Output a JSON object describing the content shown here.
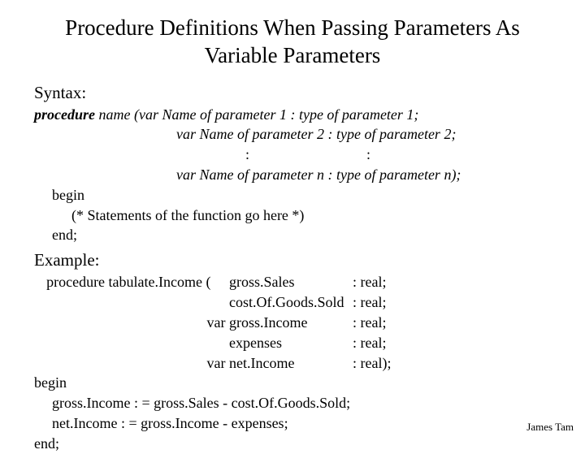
{
  "title": "Procedure Definitions When Passing Parameters As Variable Parameters",
  "syntax": {
    "heading": "Syntax:",
    "line1_kw": "procedure",
    "line1_rest": " name (var Name of parameter 1 : type of parameter 1;",
    "line2": "var Name of parameter 2 : type of parameter 2;",
    "line3": ":                                :",
    "line4": "var Name of parameter n : type of parameter n);",
    "begin": "begin",
    "body": "(* Statements of the function go here *)",
    "end": "end;"
  },
  "example": {
    "heading": "Example:",
    "sig_prefix": "procedure tabulate.Income (",
    "params": [
      {
        "prefix": "procedure tabulate.Income (     ",
        "name": "gross.Sales",
        "type": ": real;"
      },
      {
        "prefix": "",
        "name": "cost.Of.Goods.Sold ",
        "type": ": real;"
      },
      {
        "prefix": "var ",
        "name": "gross.Income",
        "type": ": real;"
      },
      {
        "prefix": "",
        "name": "expenses",
        "type": ": real;"
      },
      {
        "prefix": "var ",
        "name": "net.Income",
        "type": ": real);"
      }
    ],
    "begin": "begin",
    "stmt1": "gross.Income : = gross.Sales - cost.Of.Goods.Sold;",
    "stmt2": "net.Income : = gross.Income - expenses;",
    "end": "end;"
  },
  "footer": "James Tam"
}
